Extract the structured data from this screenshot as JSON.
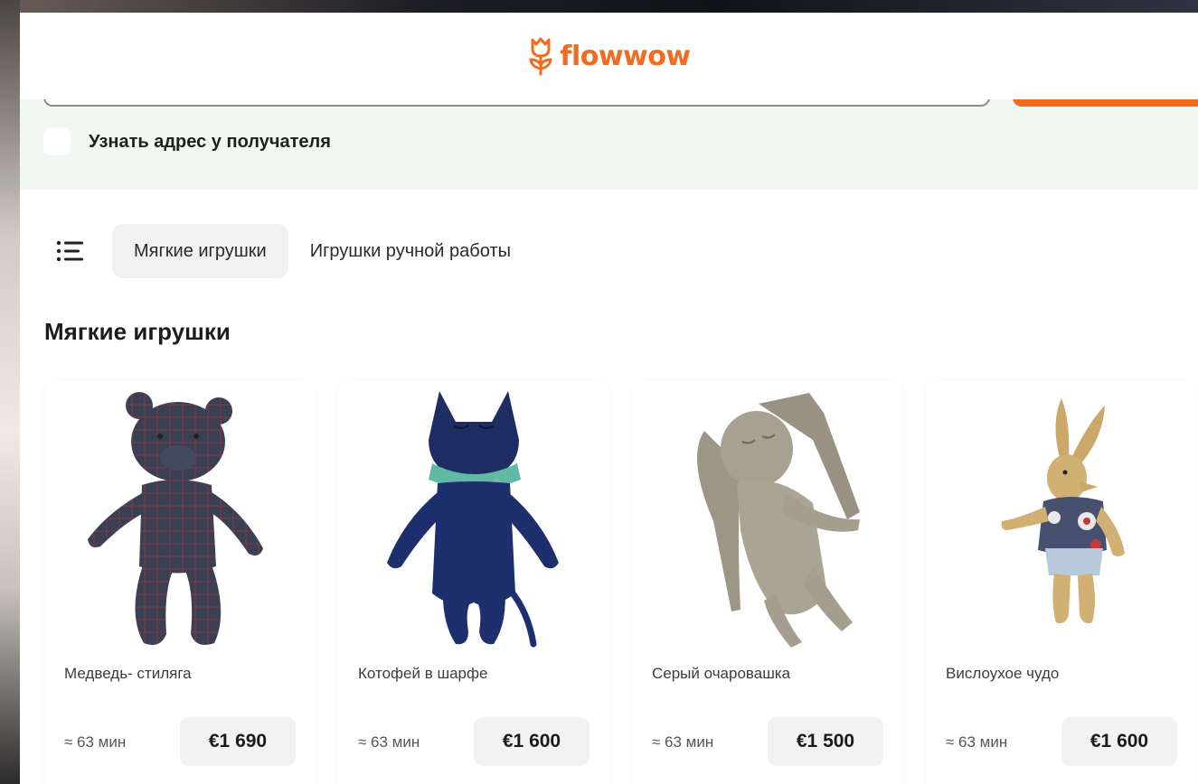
{
  "header": {
    "brand": "flowwow",
    "brand_color": "#f36b20"
  },
  "address": {
    "recipient_option_label": "Узнать адрес у получателя"
  },
  "category_tabs": [
    {
      "label": "Мягкие игрушки",
      "active": true
    },
    {
      "label": "Игрушки ручной работы",
      "active": false
    }
  ],
  "section": {
    "title": "Мягкие игрушки"
  },
  "products": [
    {
      "name": "Медведь- стиляга",
      "eta": "≈ 63 мин",
      "price": "€1 690",
      "image_icon": "bear-toy"
    },
    {
      "name": "Котофей в шарфе",
      "eta": "≈ 63 мин",
      "price": "€1 600",
      "image_icon": "cat-toy"
    },
    {
      "name": "Серый очаровашка",
      "eta": "≈ 63 мин",
      "price": "€1 500",
      "image_icon": "bunny-toy"
    },
    {
      "name": "Вислоухое чудо",
      "eta": "≈ 63 мин",
      "price": "€1 600",
      "image_icon": "rabbit-toy"
    }
  ]
}
